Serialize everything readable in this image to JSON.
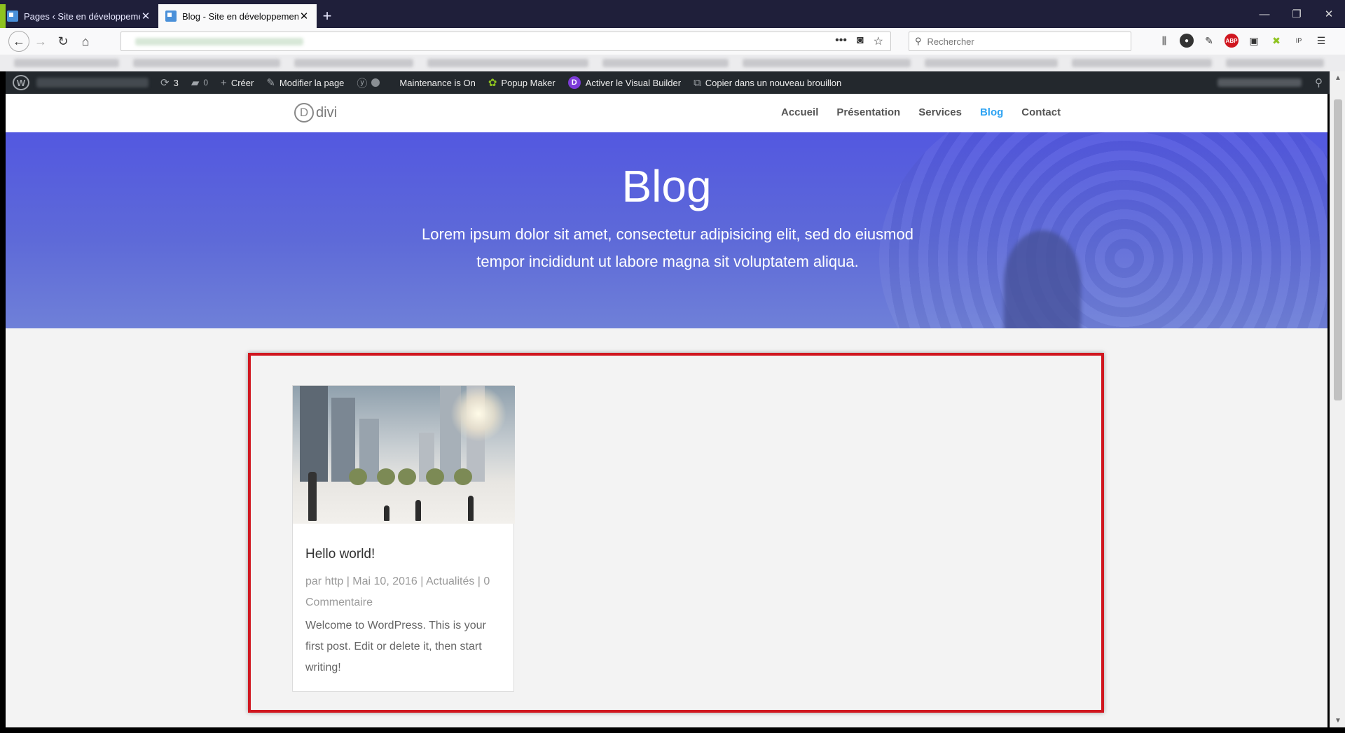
{
  "browser": {
    "tabs": [
      {
        "label": "Pages ‹ Site en développement",
        "active": false
      },
      {
        "label": "Blog - Site en développement",
        "active": true
      }
    ],
    "search_placeholder": "Rechercher"
  },
  "adminbar": {
    "updates_count": "3",
    "comments_count": "0",
    "create_label": "Créer",
    "edit_page_label": "Modifier la page",
    "maintenance_label": "Maintenance is On",
    "popup_maker_label": "Popup Maker",
    "visual_builder_label": "Activer le Visual Builder",
    "copy_draft_label": "Copier dans un nouveau brouillon"
  },
  "site": {
    "logo_text": "divi",
    "logo_letter": "D",
    "nav": [
      {
        "label": "Accueil",
        "active": false
      },
      {
        "label": "Présentation",
        "active": false
      },
      {
        "label": "Services",
        "active": false
      },
      {
        "label": "Blog",
        "active": true
      },
      {
        "label": "Contact",
        "active": false
      }
    ],
    "accent_color": "#2ea3f2"
  },
  "hero": {
    "title": "Blog",
    "subtitle": "Lorem ipsum dolor sit amet, consectetur adipisicing elit, sed do eiusmod tempor incididunt ut labore magna sit voluptatem aliqua."
  },
  "post": {
    "title": "Hello world!",
    "meta": "par http | Mai 10, 2016 | Actualités | 0 Commentaire",
    "excerpt": "Welcome to WordPress. This is your first post. Edit or delete it, then start writing!"
  },
  "annotation_color": "#d0161f"
}
